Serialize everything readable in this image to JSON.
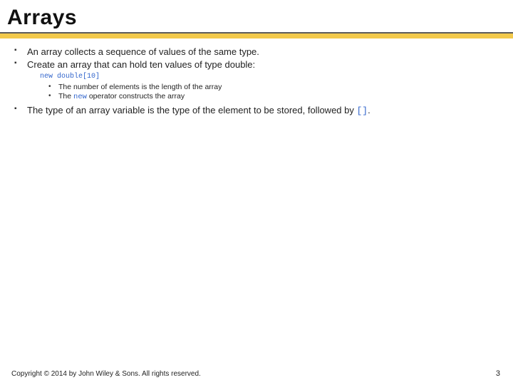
{
  "title": "Arrays",
  "bullets": {
    "b1": "An array collects a sequence of values of the same type.",
    "b2": "Create an array that can hold ten values of type double:",
    "code": "new double[10]",
    "sub1_pre": "The number of elements is the length of the array",
    "sub2_pre": "The ",
    "sub2_kw": "new",
    "sub2_post": " operator constructs the array",
    "b3_pre": "The type of an array variable is the type of the element to be stored, followed by ",
    "b3_sym": "[]",
    "b3_post": "."
  },
  "footer": "Copyright © 2014 by John Wiley & Sons. All rights reserved.",
  "page": "3"
}
